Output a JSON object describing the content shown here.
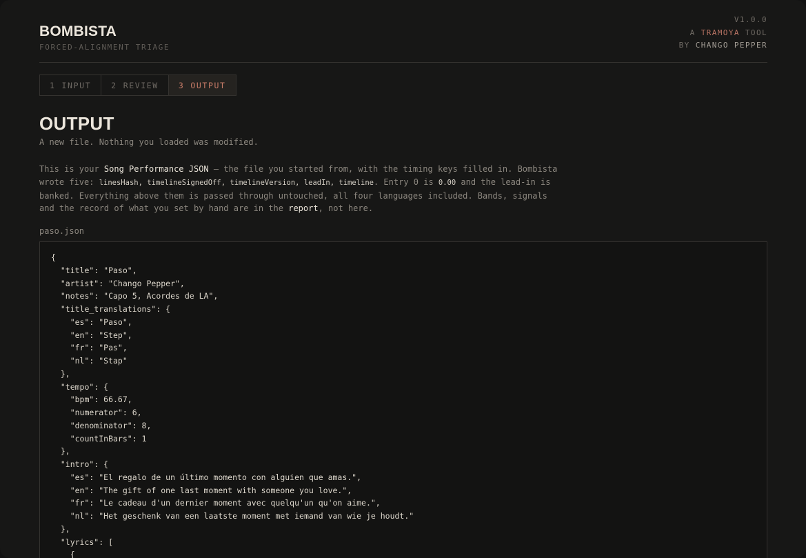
{
  "app": {
    "name": "BOMBISTA",
    "subtitle": "FORCED-ALIGNMENT TRIAGE",
    "version": "V1.0.0",
    "tool_prefix": "A",
    "tool_name": "TRAMOYA",
    "tool_suffix": "TOOL",
    "by_prefix": "BY",
    "author": "CHANGO PEPPER"
  },
  "tabs": [
    {
      "num": "1",
      "label": "INPUT",
      "active": false
    },
    {
      "num": "2",
      "label": "REVIEW",
      "active": false
    },
    {
      "num": "3",
      "label": "OUTPUT",
      "active": true
    }
  ],
  "section": {
    "title": "OUTPUT",
    "lede": "A new file. Nothing you loaded was modified.",
    "desc": {
      "p1": "This is your ",
      "hl1": "Song Performance JSON",
      "p2": " — the file you started from, with the timing keys filled in. Bombista wrote five: ",
      "keys": "linesHash, timelineSignedOff, timelineVersion, leadIn, timeline",
      "p3": ". Entry 0 is ",
      "zero": "0.00",
      "p4": " and the lead-in is banked. Everything above them is passed through untouched, all four languages included. Bands, signals and the record of what you set by hand are in the ",
      "hl2": "report",
      "p5": ", not here."
    },
    "filename": "paso.json",
    "code": "{\n  \"title\": \"Paso\",\n  \"artist\": \"Chango Pepper\",\n  \"notes\": \"Capo 5, Acordes de LA\",\n  \"title_translations\": {\n    \"es\": \"Paso\",\n    \"en\": \"Step\",\n    \"fr\": \"Pas\",\n    \"nl\": \"Stap\"\n  },\n  \"tempo\": {\n    \"bpm\": 66.67,\n    \"numerator\": 6,\n    \"denominator\": 8,\n    \"countInBars\": 1\n  },\n  \"intro\": {\n    \"es\": \"El regalo de un último momento con alguien que amas.\",\n    \"en\": \"The gift of one last moment with someone you love.\",\n    \"fr\": \"Le cadeau d'un dernier moment avec quelqu'un qu'on aime.\",\n    \"nl\": \"Het geschenk van een laatste moment met iemand van wie je houdt.\"\n  },\n  \"lyrics\": [\n    {"
  }
}
